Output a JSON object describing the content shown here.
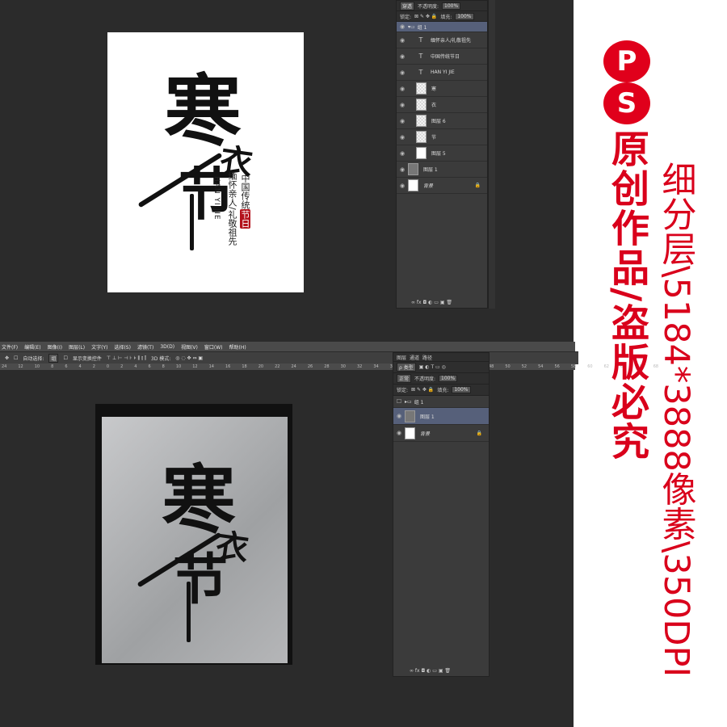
{
  "top_panel": {
    "blend": "穿透",
    "opacity_label": "不透明度:",
    "opacity_value": "100%",
    "lock_label": "锁定:",
    "fill_label": "填充:",
    "fill_value": "100%",
    "layers": [
      {
        "name": "组 1",
        "kind": "group"
      },
      {
        "name": "缅怀亲人/礼敬祖先",
        "kind": "text"
      },
      {
        "name": "中国传统节日",
        "kind": "text"
      },
      {
        "name": "HAN YI JIE",
        "kind": "text"
      },
      {
        "name": "寒",
        "kind": "raster"
      },
      {
        "name": "衣",
        "kind": "raster"
      },
      {
        "name": "图层 6",
        "kind": "raster"
      },
      {
        "name": "节",
        "kind": "raster"
      },
      {
        "name": "图层 5",
        "kind": "white"
      },
      {
        "name": "图层 1",
        "kind": "dark"
      },
      {
        "name": "背景",
        "kind": "background"
      }
    ],
    "footer_icons": "∞ fx ◘ ◐ ▭ ▣ 🗑"
  },
  "poster": {
    "title_chars": [
      "寒",
      "衣",
      "节"
    ],
    "line1": "中国传统",
    "seal": "节日",
    "line2": "缅怀亲人/礼敬祖先",
    "pinyin": "HAN YI JIE"
  },
  "menubar": [
    "文件(F)",
    "编辑(E)",
    "图像(I)",
    "图层(L)",
    "文字(Y)",
    "选择(S)",
    "滤镜(T)",
    "3D(D)",
    "视图(V)",
    "窗口(W)",
    "帮助(H)"
  ],
  "optbar": {
    "auto_select": "自动选择:",
    "auto_select_value": "组",
    "show_transform": "显示变换控件",
    "mode3d": "3D 模式:"
  },
  "ruler_ticks": [
    "24",
    "12",
    "10",
    "8",
    "6",
    "4",
    "2",
    "0",
    "2",
    "4",
    "6",
    "8",
    "10",
    "12",
    "14",
    "16",
    "18",
    "20",
    "22",
    "24",
    "26",
    "28",
    "30",
    "32",
    "34",
    "36",
    "38",
    "40",
    "42",
    "44",
    "46",
    "48",
    "50",
    "52",
    "54",
    "56",
    "58",
    "60",
    "62",
    "64",
    "66",
    "68"
  ],
  "bottom_panel": {
    "tabs": [
      "图层",
      "通道",
      "路径"
    ],
    "filter": "类型",
    "blend": "正常",
    "opacity_label": "不透明度:",
    "opacity_value": "100%",
    "lock_label": "锁定:",
    "fill_label": "填充:",
    "fill_value": "100%",
    "layers": [
      {
        "name": "组 1",
        "kind": "group"
      },
      {
        "name": "图层 1",
        "kind": "dark"
      },
      {
        "name": "背景",
        "kind": "background"
      }
    ]
  },
  "scan": {
    "title_chars": [
      "寒",
      "衣",
      "节"
    ]
  },
  "side": {
    "badge1": "P",
    "badge2": "S",
    "red_vertical": "原创作品/盗版必究",
    "info_vertical": "细分层\\5184*3888像素\\350DPI"
  },
  "colors": {
    "accent": "#d9001b",
    "ps_bg": "#2b2b2b",
    "panel": "#3b3b3b"
  }
}
